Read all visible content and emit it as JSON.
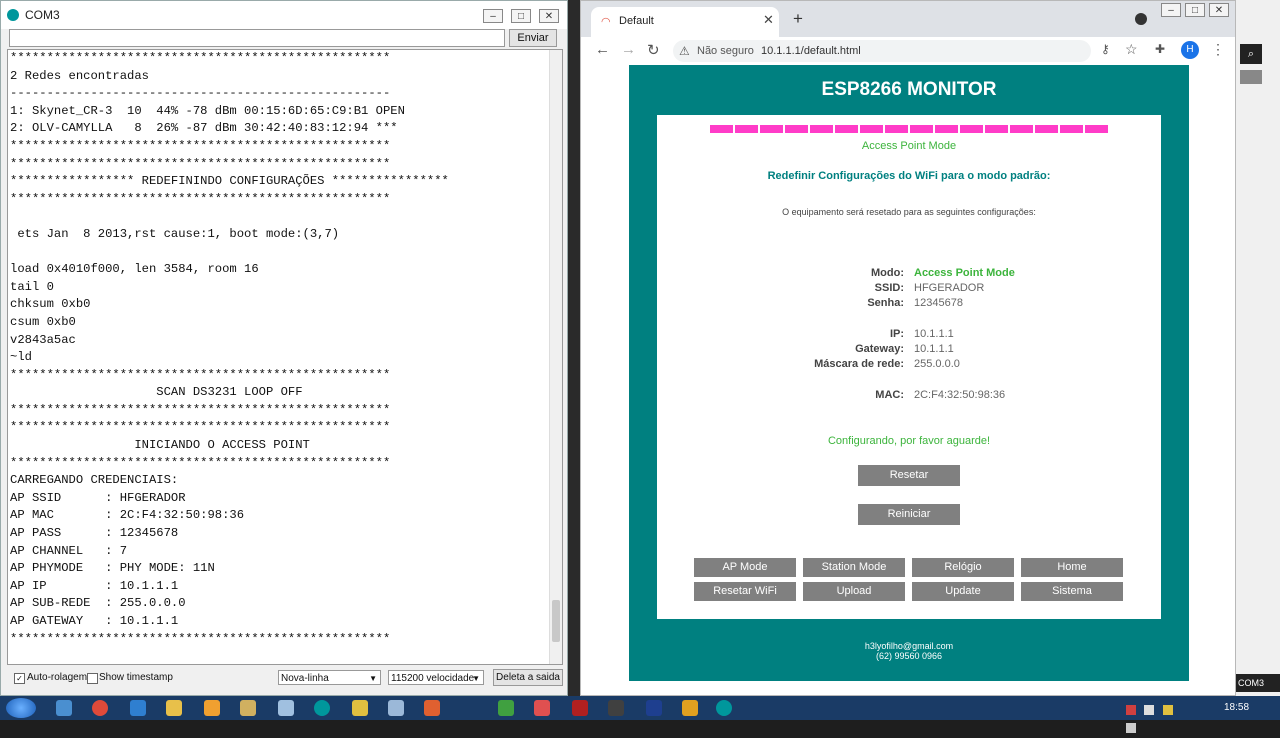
{
  "serial": {
    "title": "COM3",
    "send_label": "Enviar",
    "send_value": "",
    "console_lines": [
      "****************************************************",
      "2 Redes encontradas",
      "----------------------------------------------------",
      "1: Skynet_CR-3  10  44% -78 dBm 00:15:6D:65:C9:B1 OPEN",
      "2: OLV-CAMYLLA   8  26% -87 dBm 30:42:40:83:12:94 ***",
      "****************************************************",
      "****************************************************",
      "***************** REDEFININDO CONFIGURAÇÕES ****************",
      "****************************************************",
      "",
      " ets Jan  8 2013,rst cause:1, boot mode:(3,7)",
      "",
      "load 0x4010f000, len 3584, room 16",
      "tail 0",
      "chksum 0xb0",
      "csum 0xb0",
      "v2843a5ac",
      "~ld",
      "****************************************************",
      "                    SCAN DS3231 LOOP OFF",
      "****************************************************",
      "****************************************************",
      "                 INICIANDO O ACCESS POINT",
      "****************************************************",
      "CARREGANDO CREDENCIAIS:",
      "AP SSID      : HFGERADOR",
      "AP MAC       : 2C:F4:32:50:98:36",
      "AP PASS      : 12345678",
      "AP CHANNEL   : 7",
      "AP PHYMODE   : PHY MODE: 11N",
      "AP IP        : 10.1.1.1",
      "AP SUB-REDE  : 255.0.0.0",
      "AP GATEWAY   : 10.1.1.1",
      "****************************************************"
    ],
    "autoscroll_label": "Auto-rolagem",
    "autoscroll_checked": true,
    "timestamp_label": "Show timestamp",
    "line_ending": "Nova-linha",
    "baud": "115200 velocidade",
    "clear_label": "Deleta a saida"
  },
  "browser": {
    "tab_title": "Default",
    "not_secure_label": "Não seguro",
    "url": "10.1.1.1/default.html",
    "avatar_letter": "H"
  },
  "page": {
    "header": "ESP8266 MONITOR",
    "progress_segments": 16,
    "mode_caption": "Access Point Mode",
    "section_title": "Redefinir Configurações do WiFi para o modo padrão:",
    "description": "O equipamento será resetado para as seguintes configurações:",
    "config": [
      {
        "label": "Modo:",
        "value": "Access Point Mode",
        "highlight": true
      },
      {
        "label": "SSID:",
        "value": "HFGERADOR"
      },
      {
        "label": "Senha:",
        "value": "12345678"
      },
      {
        "label": "IP:",
        "value": "10.1.1.1"
      },
      {
        "label": "Gateway:",
        "value": "10.1.1.1"
      },
      {
        "label": "Máscara de rede:",
        "value": "255.0.0.0"
      },
      {
        "label": "MAC:",
        "value": "2C:F4:32:50:98:36"
      }
    ],
    "status": "Configurando, por favor aguarde!",
    "reset_button": "Resetar",
    "restart_button": "Reiniciar",
    "nav": [
      "AP Mode",
      "Station Mode",
      "Relógio",
      "Home",
      "Resetar WiFi",
      "Upload",
      "Update",
      "Sistema"
    ],
    "footer_email": "h3lyofilho@gmail.com",
    "footer_phone": "(62) 99560 0966"
  },
  "taskbar": {
    "clock": "18:58",
    "right_label": "COM3"
  },
  "colors": {
    "teal": "#008080",
    "pink": "#ff3cc8",
    "green": "#3cb43c",
    "button_gray": "#808080"
  }
}
